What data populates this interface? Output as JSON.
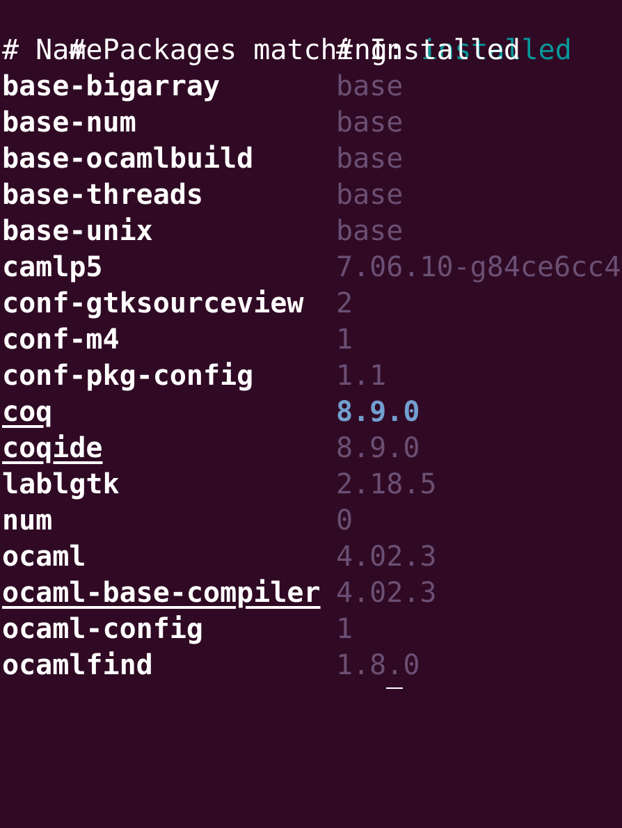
{
  "header": {
    "prefix": "# Packages matching: ",
    "query": "installed",
    "col_name": "# Name",
    "col_installed": "# Installed"
  },
  "packages": [
    {
      "name": "base-bigarray",
      "version": "base"
    },
    {
      "name": "base-num",
      "version": "base"
    },
    {
      "name": "base-ocamlbuild",
      "version": "base"
    },
    {
      "name": "base-threads",
      "version": "base"
    },
    {
      "name": "base-unix",
      "version": "base"
    },
    {
      "name": "camlp5",
      "version": "7.06.10-g84ce6cc4"
    },
    {
      "name": "conf-gtksourceview",
      "version": "2"
    },
    {
      "name": "conf-m4",
      "version": "1"
    },
    {
      "name": "conf-pkg-config",
      "version": "1.1"
    },
    {
      "name": "coq",
      "version": "8.9.0"
    },
    {
      "name": "coqide",
      "version": "8.9.0"
    },
    {
      "name": "lablgtk",
      "version": "2.18.5"
    },
    {
      "name": "num",
      "version": "0"
    },
    {
      "name": "ocaml",
      "version": "4.02.3"
    },
    {
      "name": "ocaml-base-compiler",
      "version": "4.02.3"
    },
    {
      "name": "ocaml-config",
      "version": "1"
    },
    {
      "name": "ocamlfind",
      "version": "1.8.0"
    }
  ],
  "colors": {
    "background": "#300a24",
    "query": "#06989a",
    "version": "#6b4f74",
    "highlighted_version": "#729fcf",
    "text": "#ffffff"
  }
}
